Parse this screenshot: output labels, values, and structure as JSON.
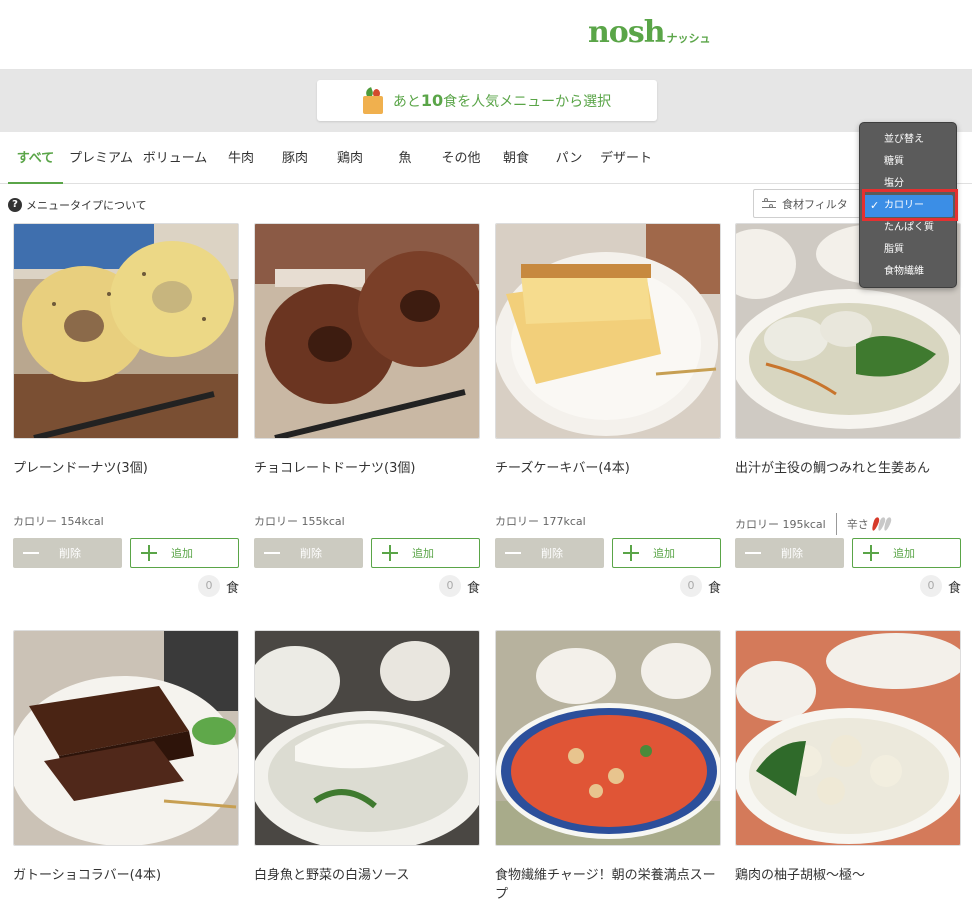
{
  "header": {
    "logo": "nosh",
    "logo_sub": "ナッシュ"
  },
  "banner": {
    "prefix": "あと",
    "count": "10",
    "suffix": "食を人気メニューから選択"
  },
  "tabs": [
    {
      "label": "すべて",
      "active": true
    },
    {
      "label": "プレミアム"
    },
    {
      "label": "ボリューム"
    },
    {
      "label": "牛肉"
    },
    {
      "label": "豚肉"
    },
    {
      "label": "鶏肉"
    },
    {
      "label": "魚"
    },
    {
      "label": "その他"
    },
    {
      "label": "朝食"
    },
    {
      "label": "パン"
    },
    {
      "label": "デザート"
    }
  ],
  "info": {
    "icon": "?",
    "text": "メニュータイプについて"
  },
  "filter": {
    "label": "食材フィルタ"
  },
  "sort_menu": {
    "items": [
      {
        "label": "並び替え"
      },
      {
        "label": "糖質"
      },
      {
        "label": "塩分"
      },
      {
        "label": "カロリー",
        "selected": true,
        "check": "✓"
      },
      {
        "label": "たんぱく質"
      },
      {
        "label": "脂質"
      },
      {
        "label": "食物繊維"
      }
    ]
  },
  "card_labels": {
    "delete": "削除",
    "add": "追加",
    "unit": "食",
    "spice_label": "辛さ"
  },
  "products": [
    {
      "name": "プレーンドーナツ(3個)",
      "calories": "カロリー 154kcal",
      "count": "0"
    },
    {
      "name": "チョコレートドーナツ(3個)",
      "calories": "カロリー 155kcal",
      "count": "0"
    },
    {
      "name": "チーズケーキバー(4本)",
      "calories": "カロリー 177kcal",
      "count": "0"
    },
    {
      "name": "出汁が主役の鯛つみれと生姜あん",
      "calories": "カロリー 195kcal",
      "count": "0",
      "spice_level": 1
    },
    {
      "name": "ガトーショコラバー(4本)"
    },
    {
      "name": "白身魚と野菜の白湯ソース"
    },
    {
      "name": "食物繊維チャージ！朝の栄養満点スープ"
    },
    {
      "name": "鶏肉の柚子胡椒〜極〜"
    }
  ],
  "colors": {
    "brand": "#5aa548",
    "selected": "#3b8ee6",
    "highlight": "#e53030",
    "pepper_hot": "#d63a2a",
    "pepper_mild": "#c8c8c8"
  }
}
